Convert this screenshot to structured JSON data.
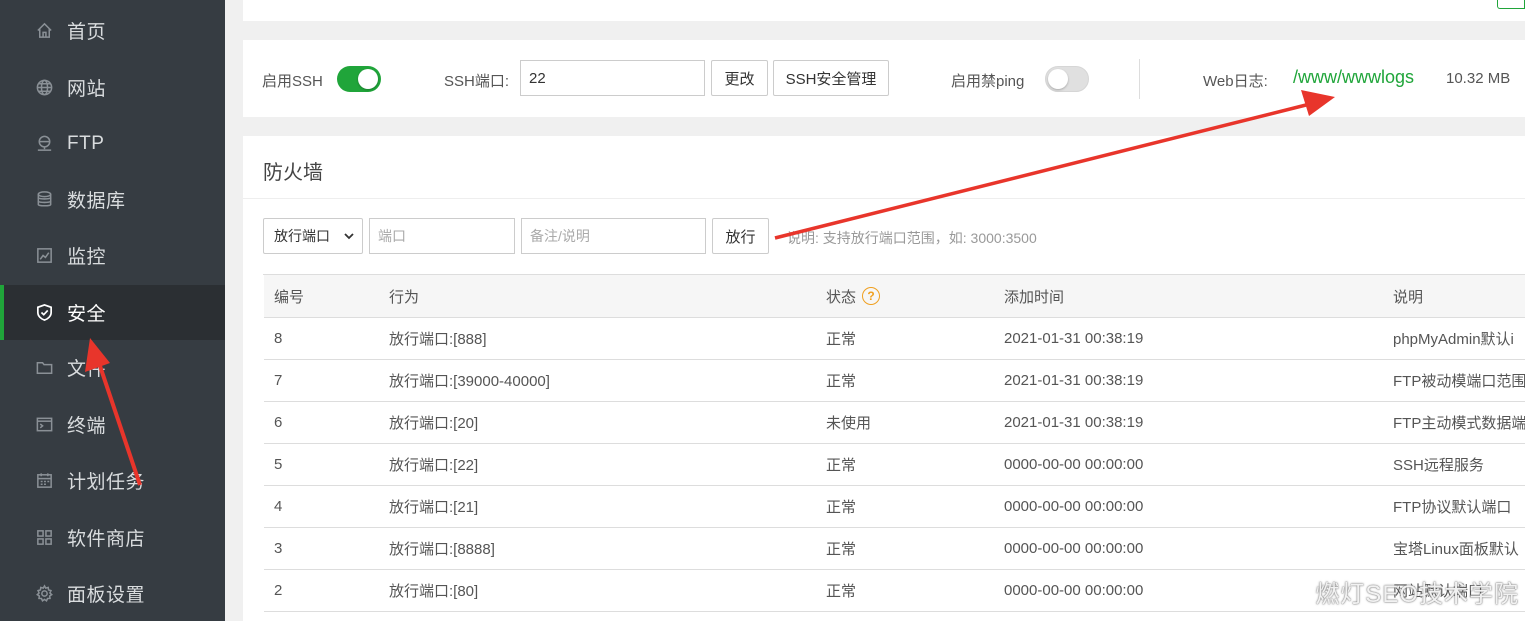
{
  "sidebar": {
    "items": [
      {
        "label": "首页",
        "icon": "home-icon"
      },
      {
        "label": "网站",
        "icon": "globe-icon"
      },
      {
        "label": "FTP",
        "icon": "ftp-icon"
      },
      {
        "label": "数据库",
        "icon": "database-icon"
      },
      {
        "label": "监控",
        "icon": "monitor-icon"
      },
      {
        "label": "安全",
        "icon": "shield-icon",
        "active": true
      },
      {
        "label": "文件",
        "icon": "folder-icon"
      },
      {
        "label": "终端",
        "icon": "terminal-icon"
      },
      {
        "label": "计划任务",
        "icon": "calendar-icon"
      },
      {
        "label": "软件商店",
        "icon": "apps-grid-icon"
      },
      {
        "label": "面板设置",
        "icon": "gear-icon"
      }
    ]
  },
  "settings": {
    "ssh_label": "启用SSH",
    "ssh_enabled": true,
    "port_label": "SSH端口:",
    "port_value": "22",
    "change_button": "更改",
    "ssh_manage_button": "SSH安全管理",
    "ping_label": "启用禁ping",
    "ping_enabled": false,
    "web_log_label": "Web日志:",
    "web_log_path": "/www/wwwlogs",
    "web_log_size": "10.32 MB"
  },
  "firewall": {
    "title": "防火墙",
    "select_value": "放行端口",
    "port_placeholder": "端口",
    "note_placeholder": "备注/说明",
    "allow_button": "放行",
    "hint": "说明: 支持放行端口范围，如: 3000:3500",
    "columns": [
      "编号",
      "行为",
      "状态",
      "添加时间",
      "说明"
    ],
    "status_help": "?",
    "rows": [
      {
        "id": "8",
        "action": "放行端口:[888]",
        "status": "正常",
        "time": "2021-01-31 00:38:19",
        "note": "phpMyAdmin默认i"
      },
      {
        "id": "7",
        "action": "放行端口:[39000-40000]",
        "status": "正常",
        "time": "2021-01-31 00:38:19",
        "note": "FTP被动模端口范围"
      },
      {
        "id": "6",
        "action": "放行端口:[20]",
        "status": "未使用",
        "time": "2021-01-31 00:38:19",
        "note": "FTP主动模式数据端"
      },
      {
        "id": "5",
        "action": "放行端口:[22]",
        "status": "正常",
        "time": "0000-00-00 00:00:00",
        "note": "SSH远程服务"
      },
      {
        "id": "4",
        "action": "放行端口:[21]",
        "status": "正常",
        "time": "0000-00-00 00:00:00",
        "note": "FTP协议默认端口"
      },
      {
        "id": "3",
        "action": "放行端口:[8888]",
        "status": "正常",
        "time": "0000-00-00 00:00:00",
        "note": "宝塔Linux面板默认"
      },
      {
        "id": "2",
        "action": "放行端口:[80]",
        "status": "正常",
        "time": "0000-00-00 00:00:00",
        "note": "网站默认端口"
      }
    ]
  },
  "watermark": "燃灯SEO技术学院",
  "colors": {
    "accent": "#20a53a",
    "sidebar_bg": "#363c42",
    "arrow": "#e8352b"
  }
}
